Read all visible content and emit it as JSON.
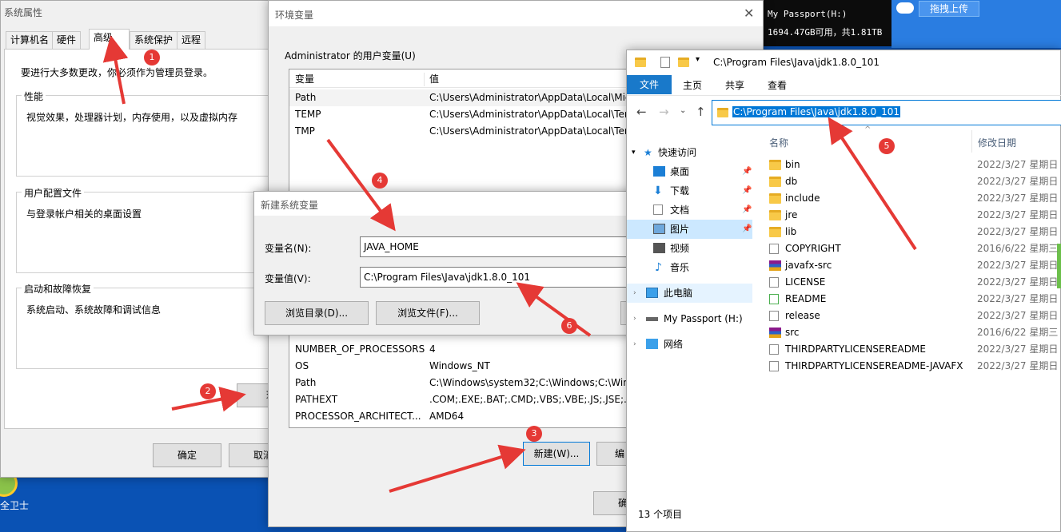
{
  "desktop": {
    "drive_name": "My Passport(H:)",
    "drive_space": "1694.47GB可用，共1.81TB",
    "upload_button": "拖拽上传",
    "security_app_label": "全卫士"
  },
  "sysprops": {
    "title": "系统属性",
    "tabs": [
      "计算机名",
      "硬件",
      "高级",
      "系统保护",
      "远程"
    ],
    "admin_note": "要进行大多数更改，你必须作为管理员登录。",
    "performance": {
      "label": "性能",
      "desc": "视觉效果，处理器计划，内存使用，以及虚拟内存"
    },
    "profile": {
      "label": "用户配置文件",
      "desc": "与登录帐户相关的桌面设置"
    },
    "startup": {
      "label": "启动和故障恢复",
      "desc": "系统启动、系统故障和调试信息"
    },
    "env_button_partial": "环",
    "ok": "确定",
    "cancel_partial": "取消"
  },
  "envvars": {
    "title": "环境变量",
    "user_group_label": "Administrator 的用户变量(U)",
    "col_var": "变量",
    "col_val": "值",
    "user_vars": [
      {
        "name": "Path",
        "value": "C:\\Users\\Administrator\\AppData\\Local\\Mic"
      },
      {
        "name": "TEMP",
        "value": "C:\\Users\\Administrator\\AppData\\Local\\Ter"
      },
      {
        "name": "TMP",
        "value": "C:\\Users\\Administrator\\AppData\\Local\\Ter"
      }
    ],
    "sys_vars": [
      {
        "name": "NUMBER_OF_PROCESSORS",
        "value": "4"
      },
      {
        "name": "OS",
        "value": "Windows_NT"
      },
      {
        "name": "Path",
        "value": "C:\\Windows\\system32;C:\\Windows;C:\\Wind"
      },
      {
        "name": "PATHEXT",
        "value": ".COM;.EXE;.BAT;.CMD;.VBS;.VBE;.JS;.JSE;.WS"
      },
      {
        "name": "PROCESSOR_ARCHITECT...",
        "value": "AMD64"
      }
    ],
    "new_button": "新建(W)...",
    "edit_partial": "编",
    "ok_partial": "确"
  },
  "newvar": {
    "title": "新建系统变量",
    "name_label": "变量名(N):",
    "name_value": "JAVA_HOME",
    "value_label": "变量值(V):",
    "value_value": "C:\\Program Files\\Java\\jdk1.8.0_101",
    "browse_dir": "浏览目录(D)...",
    "browse_file": "浏览文件(F)..."
  },
  "explorer": {
    "title_path": "C:\\Program Files\\Java\\jdk1.8.0_101",
    "ribbon_tabs": [
      "文件",
      "主页",
      "共享",
      "查看"
    ],
    "address": "C:\\Program Files\\Java\\jdk1.8.0_101",
    "col_name": "名称",
    "col_date": "修改日期",
    "quick_access": "快速访问",
    "nav": [
      {
        "label": "桌面",
        "pinned": true
      },
      {
        "label": "下载",
        "pinned": true
      },
      {
        "label": "文档",
        "pinned": true
      },
      {
        "label": "图片",
        "pinned": true
      },
      {
        "label": "视频",
        "pinned": false
      },
      {
        "label": "音乐",
        "pinned": false
      }
    ],
    "this_pc": "此电脑",
    "passport": "My Passport (H:)",
    "network": "网络",
    "files": [
      {
        "name": "bin",
        "date": "2022/3/27 星期日",
        "icon": "folder-icon"
      },
      {
        "name": "db",
        "date": "2022/3/27 星期日",
        "icon": "folder-icon"
      },
      {
        "name": "include",
        "date": "2022/3/27 星期日",
        "icon": "folder-icon"
      },
      {
        "name": "jre",
        "date": "2022/3/27 星期日",
        "icon": "folder-icon"
      },
      {
        "name": "lib",
        "date": "2022/3/27 星期日",
        "icon": "folder-icon"
      },
      {
        "name": "COPYRIGHT",
        "date": "2016/6/22 星期三",
        "icon": "file-icon"
      },
      {
        "name": "javafx-src",
        "date": "2022/3/27 星期日",
        "icon": "archive-icon"
      },
      {
        "name": "LICENSE",
        "date": "2022/3/27 星期日",
        "icon": "file-icon"
      },
      {
        "name": "README",
        "date": "2022/3/27 星期日",
        "icon": "html-file-icon"
      },
      {
        "name": "release",
        "date": "2022/3/27 星期日",
        "icon": "file-icon"
      },
      {
        "name": "src",
        "date": "2016/6/22 星期三",
        "icon": "archive-icon"
      },
      {
        "name": "THIRDPARTYLICENSEREADME",
        "date": "2022/3/27 星期日",
        "icon": "text-file-icon"
      },
      {
        "name": "THIRDPARTYLICENSEREADME-JAVAFX",
        "date": "2022/3/27 星期日",
        "icon": "text-file-icon"
      }
    ],
    "item_count": "13 个项目"
  },
  "annotations": [
    "1",
    "2",
    "3",
    "4",
    "5",
    "6"
  ],
  "colors": {
    "accent": "#0078d7",
    "desktop": "#0a52b4",
    "annotation": "#e53935"
  }
}
